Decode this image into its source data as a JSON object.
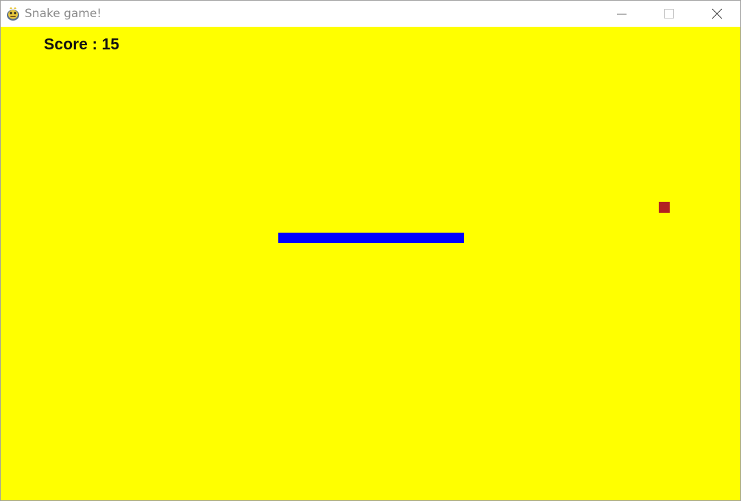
{
  "window": {
    "title": "Snake game!",
    "app_icon": "pygame-snake-icon",
    "controls": [
      "minimize-icon",
      "maximize-icon",
      "close-icon"
    ]
  },
  "game": {
    "score_text": "Score : 15",
    "score": 15,
    "colors": {
      "background": "#ffff00",
      "snake": "#0000ff",
      "food": "#b22222",
      "score_text": "#111111"
    }
  }
}
